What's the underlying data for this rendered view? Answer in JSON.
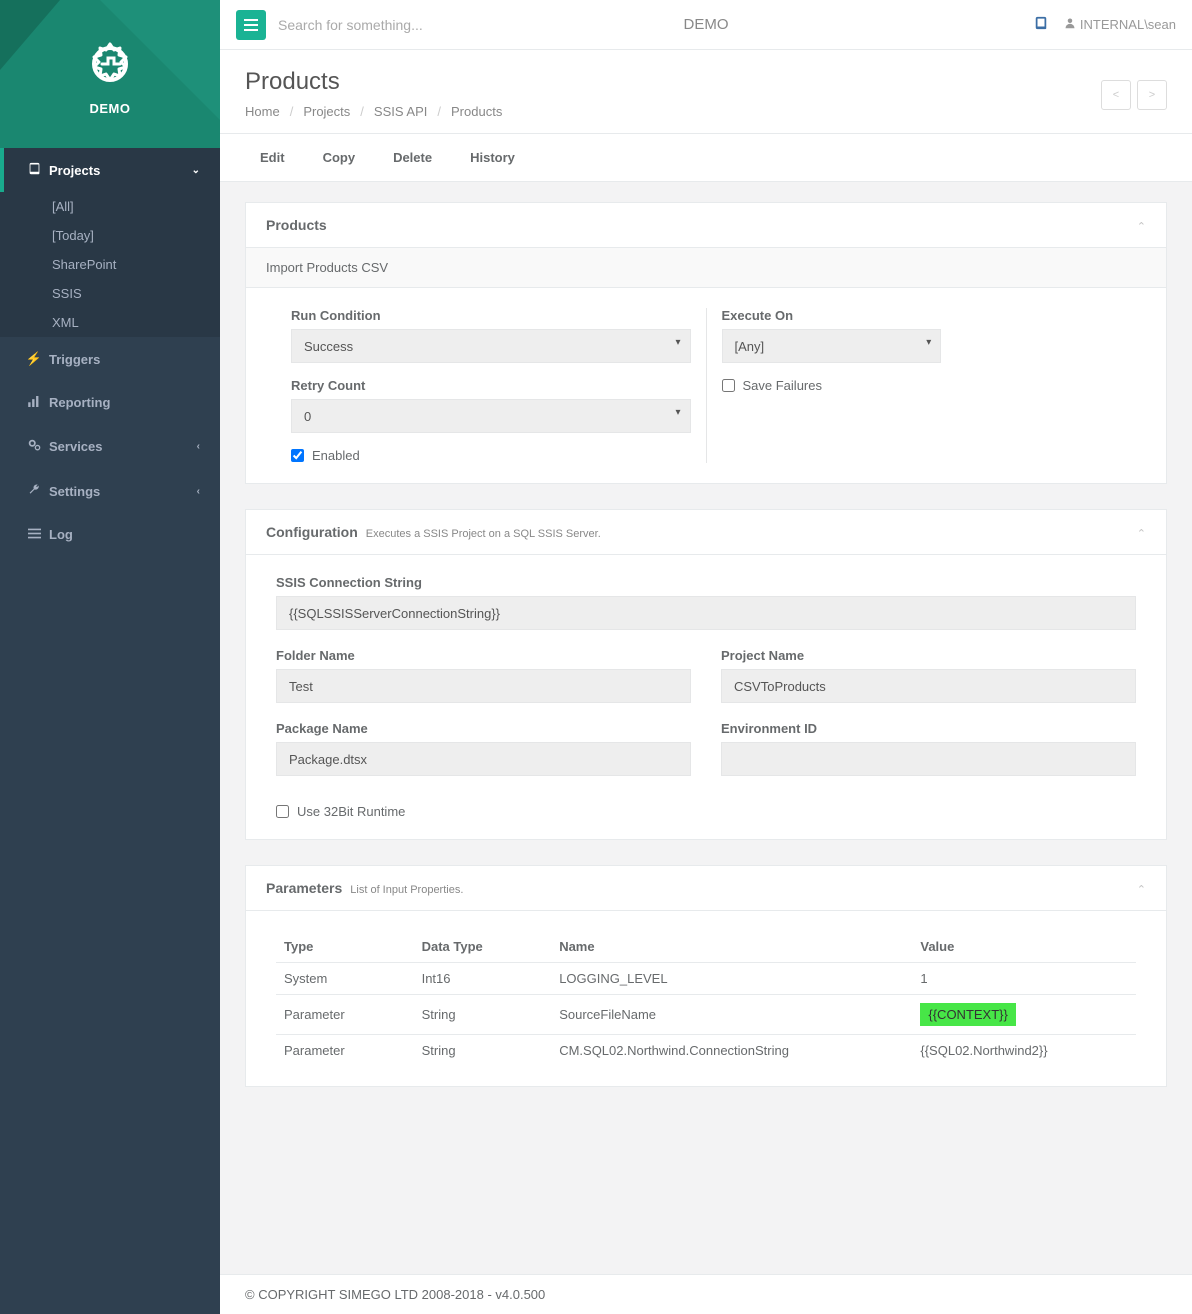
{
  "app": {
    "name": "DEMO",
    "top_title": "DEMO"
  },
  "search": {
    "placeholder": "Search for something..."
  },
  "user": {
    "name": "INTERNAL\\sean"
  },
  "sidebar": {
    "items": [
      {
        "label": "Projects",
        "icon": "book",
        "active": true,
        "expandable": true
      },
      {
        "label": "Triggers",
        "icon": "bolt"
      },
      {
        "label": "Reporting",
        "icon": "chart"
      },
      {
        "label": "Services",
        "icon": "cogs",
        "expandable": true
      },
      {
        "label": "Settings",
        "icon": "wrench",
        "expandable": true
      },
      {
        "label": "Log",
        "icon": "list"
      }
    ],
    "projects_submenu": [
      {
        "label": "[All]"
      },
      {
        "label": "[Today]"
      },
      {
        "label": "SharePoint"
      },
      {
        "label": "SSIS"
      },
      {
        "label": "XML"
      }
    ]
  },
  "page": {
    "title": "Products"
  },
  "breadcrumb": [
    {
      "label": "Home"
    },
    {
      "label": "Projects"
    },
    {
      "label": "SSIS API"
    },
    {
      "label": "Products"
    }
  ],
  "actions": [
    {
      "label": "Edit"
    },
    {
      "label": "Copy"
    },
    {
      "label": "Delete"
    },
    {
      "label": "History"
    }
  ],
  "panels": {
    "products": {
      "title": "Products",
      "subtitle": "Import Products CSV",
      "fields": {
        "run_condition": {
          "label": "Run Condition",
          "value": "Success"
        },
        "retry_count": {
          "label": "Retry Count",
          "value": "0"
        },
        "enabled": {
          "label": "Enabled",
          "checked": true
        },
        "execute_on": {
          "label": "Execute On",
          "value": "[Any]"
        },
        "save_failures": {
          "label": "Save Failures",
          "checked": false
        }
      }
    },
    "configuration": {
      "title": "Configuration",
      "subtitle": "Executes a SSIS Project on a SQL SSIS Server.",
      "fields": {
        "conn_string": {
          "label": "SSIS Connection String",
          "value": "{{SQLSSISServerConnectionString}}"
        },
        "folder_name": {
          "label": "Folder Name",
          "value": "Test"
        },
        "project_name": {
          "label": "Project Name",
          "value": "CSVToProducts"
        },
        "package_name": {
          "label": "Package Name",
          "value": "Package.dtsx"
        },
        "environment_id": {
          "label": "Environment ID",
          "value": ""
        },
        "use_32bit": {
          "label": "Use 32Bit Runtime",
          "checked": false
        }
      }
    },
    "parameters": {
      "title": "Parameters",
      "subtitle": "List of Input Properties.",
      "columns": [
        {
          "label": "Type"
        },
        {
          "label": "Data Type"
        },
        {
          "label": "Name"
        },
        {
          "label": "Value"
        }
      ],
      "rows": [
        {
          "type": "System",
          "datatype": "Int16",
          "name": "LOGGING_LEVEL",
          "value": "1",
          "highlight": false
        },
        {
          "type": "Parameter",
          "datatype": "String",
          "name": "SourceFileName",
          "value": "{{CONTEXT}}",
          "highlight": true
        },
        {
          "type": "Parameter",
          "datatype": "String",
          "name": "CM.SQL02.Northwind.ConnectionString",
          "value": "{{SQL02.Northwind2}}",
          "highlight": false
        }
      ]
    }
  },
  "footer": {
    "text": "© COPYRIGHT SIMEGO LTD 2008-2018 - v4.0.500"
  },
  "pager": {
    "prev": "<",
    "next": ">"
  }
}
